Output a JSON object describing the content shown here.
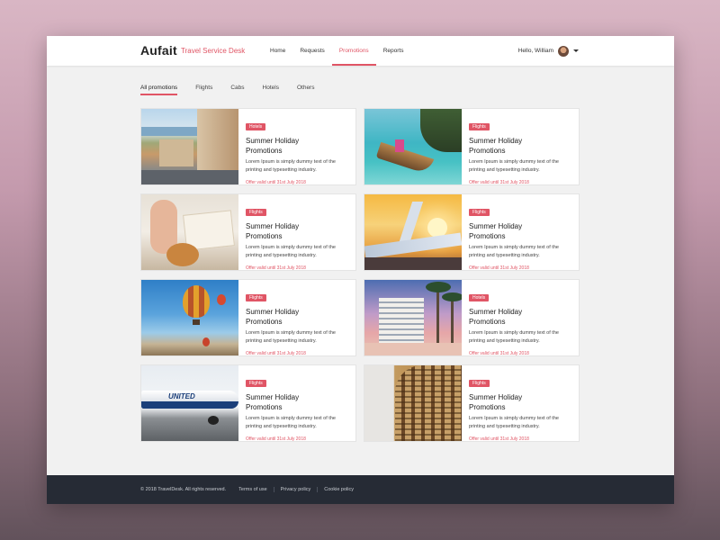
{
  "brand": {
    "name": "Aufait",
    "subtitle": "Travel Service Desk"
  },
  "nav": {
    "items": [
      "Home",
      "Requests",
      "Promotions",
      "Reports"
    ],
    "active": "Promotions"
  },
  "user": {
    "greeting": "Hello, William"
  },
  "filter_tabs": {
    "items": [
      "All promotions",
      "Flights",
      "Cabs",
      "Hotels",
      "Others"
    ],
    "active": "All promotions"
  },
  "cards": [
    {
      "badge": "Hotels",
      "title": "Summer Holiday Promotions",
      "description": "Lorem Ipsum is simply dummy text of the printing and typesetting industry.",
      "validity": "Offer valid until 31st July 2018",
      "image": "city-street"
    },
    {
      "badge": "Flights",
      "title": "Summer Holiday Promotions",
      "description": "Lorem Ipsum is simply dummy text of the printing and typesetting industry.",
      "validity": "Offer valid until 31st July 2018",
      "image": "longtail-boat"
    },
    {
      "badge": "Flights",
      "title": "Summer Holiday Promotions",
      "description": "Lorem Ipsum is simply dummy text of the printing and typesetting industry.",
      "validity": "Offer valid until 31st July 2018",
      "image": "couple-with-map"
    },
    {
      "badge": "Flights",
      "title": "Summer Holiday Promotions",
      "description": "Lorem Ipsum is simply dummy text of the printing and typesetting industry.",
      "validity": "Offer valid until 31st July 2018",
      "image": "airplane-sunset"
    },
    {
      "badge": "Flights",
      "title": "Summer Holiday Promotions",
      "description": "Lorem Ipsum is simply dummy text of the printing and typesetting industry.",
      "validity": "Offer valid until 31st July 2018",
      "image": "hot-air-balloons"
    },
    {
      "badge": "Hotels",
      "title": "Summer Holiday Promotions",
      "description": "Lorem Ipsum is simply dummy text of the printing and typesetting industry.",
      "validity": "Offer valid until 31st July 2018",
      "image": "beach-resort"
    },
    {
      "badge": "Flights",
      "title": "Summer Holiday Promotions",
      "description": "Lorem Ipsum is simply dummy text of the printing and typesetting industry.",
      "validity": "Offer valid until 31st July 2018",
      "image": "united-airliner"
    },
    {
      "badge": "Flights",
      "title": "Summer Holiday Promotions",
      "description": "Lorem Ipsum is simply dummy text of the printing and typesetting industry.",
      "validity": "Offer valid until 31st July 2018",
      "image": "colosseum"
    }
  ],
  "footer": {
    "copyright": "© 2018 TravelDesk. All rights reserved.",
    "links": [
      "Terms of use",
      "Privacy policy",
      "Cookie policy"
    ]
  },
  "colors": {
    "accent": "#e05565",
    "footer_bg": "#262b35",
    "page_bg": "#f1f1f1"
  }
}
